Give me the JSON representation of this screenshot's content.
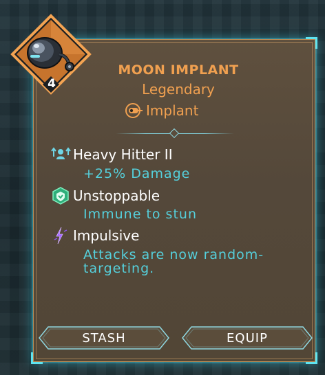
{
  "item": {
    "name": "MOON IMPLANT",
    "rarity": "Legendary",
    "type": "Implant",
    "level": "4",
    "icon": "moon-implant-icon"
  },
  "traits": [
    {
      "name": "Heavy Hitter II",
      "description": "+25% Damage",
      "icon": "heavy-hitter-icon"
    },
    {
      "name": "Unstoppable",
      "description": "Immune to stun",
      "icon": "shield-icon"
    },
    {
      "name": "Impulsive",
      "description": "Attacks are now random-targeting.",
      "icon": "impulsive-icon"
    }
  ],
  "buttons": {
    "stash": "STASH",
    "equip": "EQUIP"
  },
  "colors": {
    "accent": "#f0a050",
    "cyan": "#55d0dc",
    "card_bg": "#564a3a",
    "glow": "#5fe4f0"
  }
}
